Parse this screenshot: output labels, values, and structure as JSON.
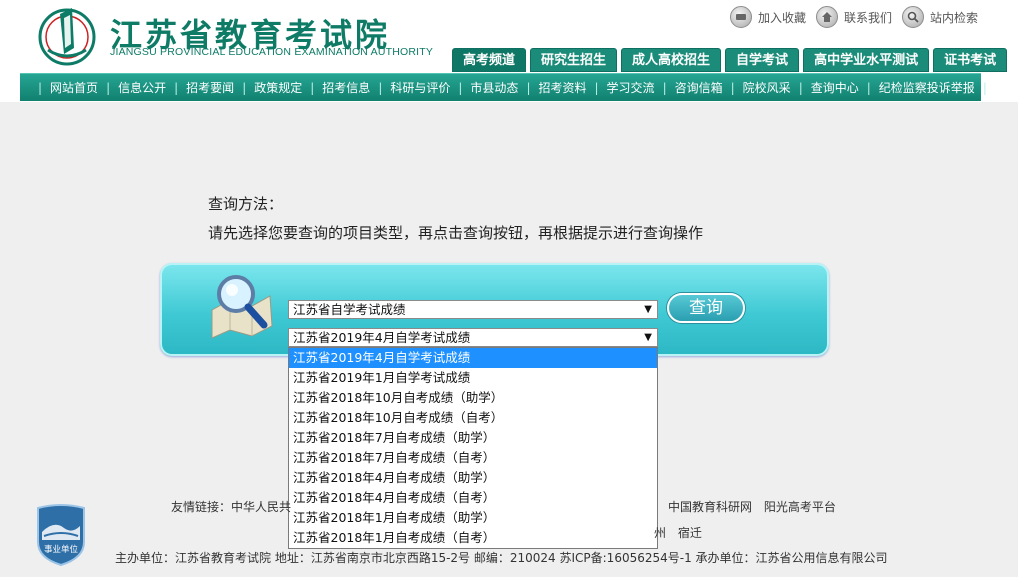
{
  "header": {
    "logo_cn": "江苏省教育考试院",
    "logo_en": "JIANGSU PROVINCIAL EDUCATION EXAMINATION AUTHORITY",
    "top_links": [
      "加入收藏",
      "联系我们",
      "站内检索"
    ],
    "tabs": [
      "高考频道",
      "研究生招生",
      "成人高校招生",
      "自学考试",
      "高中学业水平测试",
      "证书考试"
    ]
  },
  "nav": {
    "items": [
      "网站首页",
      "信息公开",
      "招考要闻",
      "政策规定",
      "招考信息",
      "科研与评价",
      "市县动态",
      "招考资料",
      "学习交流",
      "咨询信箱",
      "院校风采",
      "查询中心",
      "纪检监察投诉举报"
    ]
  },
  "main": {
    "method_title": "查询方法：",
    "method_desc": "请先选择您要查询的项目类型，再点击查询按钮，再根据提示进行查询操作",
    "select_type": "江苏省自学考试成绩",
    "select_exam": "江苏省2019年4月自学考试成绩",
    "query_button": "查询",
    "dropdown_options": [
      "江苏省2019年4月自学考试成绩",
      "江苏省2019年1月自学考试成绩",
      "江苏省2018年10月自考成绩（助学）",
      "江苏省2018年10月自考成绩（自考）",
      "江苏省2018年7月自考成绩（助学）",
      "江苏省2018年7月自考成绩（自考）",
      "江苏省2018年4月自考成绩（助学）",
      "江苏省2018年4月自考成绩（自考）",
      "江苏省2018年1月自考成绩（助学）",
      "江苏省2018年1月自考成绩（自考）"
    ]
  },
  "footer": {
    "links_label": "友情链接：中华人民共",
    "links_right_row1": [
      "中国教育科研网",
      "阳光高考平台"
    ],
    "links_right_row2": [
      "州",
      "宿迁"
    ],
    "badge_text": "事业单位",
    "info": "主办单位：江苏省教育考试院  地址：江苏省南京市北京西路15-2号  邮编：210024  苏ICP备:16056254号-1  承办单位：江苏省公用信息有限公司"
  },
  "colors": {
    "brand_green": "#0d7b66",
    "nav_teal": "#1b8c7a",
    "panel_cyan": "#3fc9d4",
    "selected_blue": "#1e90ff"
  }
}
